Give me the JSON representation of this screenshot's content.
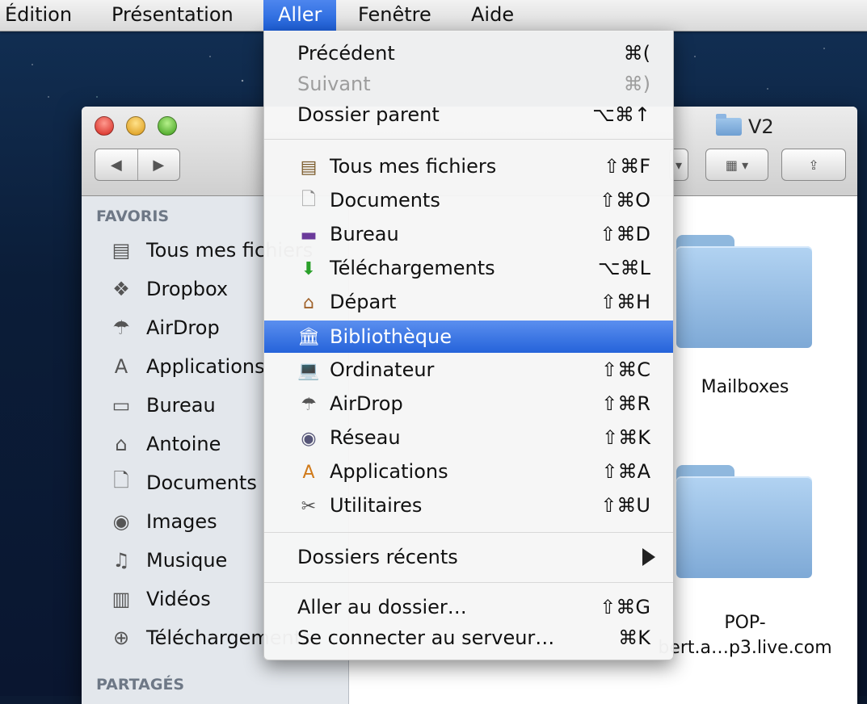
{
  "menubar": {
    "items": [
      "Édition",
      "Présentation",
      "Aller",
      "Fenêtre",
      "Aide"
    ],
    "active": "Aller"
  },
  "window": {
    "title": "V2",
    "sidebar_sections": [
      "FAVORIS",
      "PARTAGÉS"
    ],
    "sidebar_items": [
      "Tous mes fichiers",
      "Dropbox",
      "AirDrop",
      "Applications",
      "Bureau",
      "Antoine",
      "Documents",
      "Images",
      "Musique",
      "Vidéos",
      "Téléchargements"
    ],
    "content_items": [
      "Mailboxes",
      "POP-",
      "bert.a…p3.live.com"
    ]
  },
  "menu": {
    "top": [
      {
        "label": "Précédent",
        "shortcut": "⌘(",
        "enabled": true
      },
      {
        "label": "Suivant",
        "shortcut": "⌘)",
        "enabled": false
      },
      {
        "label": "Dossier parent",
        "shortcut": "⌥⌘↑",
        "enabled": true
      }
    ],
    "places": [
      {
        "label": "Tous mes fichiers",
        "shortcut": "⇧⌘F",
        "icon": "all-files-icon"
      },
      {
        "label": "Documents",
        "shortcut": "⇧⌘O",
        "icon": "document-icon"
      },
      {
        "label": "Bureau",
        "shortcut": "⇧⌘D",
        "icon": "desktop-icon"
      },
      {
        "label": "Téléchargements",
        "shortcut": "⌥⌘L",
        "icon": "download-icon"
      },
      {
        "label": "Départ",
        "shortcut": "⇧⌘H",
        "icon": "home-icon"
      },
      {
        "label": "Bibliothèque",
        "shortcut": "",
        "icon": "library-icon",
        "highlighted": true
      },
      {
        "label": "Ordinateur",
        "shortcut": "⇧⌘C",
        "icon": "computer-icon"
      },
      {
        "label": "AirDrop",
        "shortcut": "⇧⌘R",
        "icon": "airdrop-icon"
      },
      {
        "label": "Réseau",
        "shortcut": "⇧⌘K",
        "icon": "network-icon"
      },
      {
        "label": "Applications",
        "shortcut": "⇧⌘A",
        "icon": "applications-icon"
      },
      {
        "label": "Utilitaires",
        "shortcut": "⇧⌘U",
        "icon": "utilities-icon"
      }
    ],
    "recent": {
      "label": "Dossiers récents"
    },
    "bottom": [
      {
        "label": "Aller au dossier…",
        "shortcut": "⇧⌘G"
      },
      {
        "label": "Se connecter au serveur…",
        "shortcut": "⌘K"
      }
    ]
  },
  "colors": {
    "highlight": "#2563da",
    "menubar_active": "#1d5fd8",
    "folder": "#8fb8de"
  }
}
